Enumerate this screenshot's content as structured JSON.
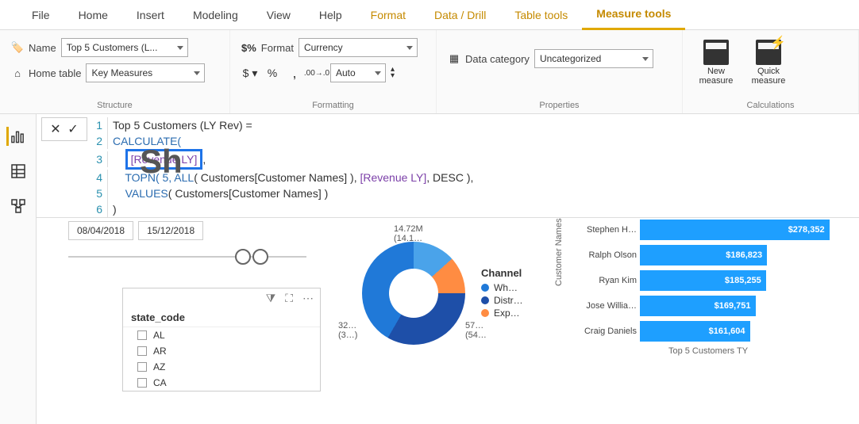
{
  "tabs": {
    "file": "File",
    "home": "Home",
    "insert": "Insert",
    "modeling": "Modeling",
    "view": "View",
    "help": "Help",
    "format": "Format",
    "datadrill": "Data / Drill",
    "tabletools": "Table tools",
    "measuretools": "Measure tools"
  },
  "structure": {
    "name_label": "Name",
    "name_value": "Top 5 Customers (L...",
    "home_label": "Home table",
    "home_value": "Key Measures",
    "group": "Structure"
  },
  "formatting": {
    "format_label": "Format",
    "format_value": "Currency",
    "decimals": "Auto",
    "group": "Formatting"
  },
  "properties": {
    "datacat_label": "Data category",
    "datacat_value": "Uncategorized",
    "group": "Properties"
  },
  "calculations": {
    "new": "New measure",
    "quick": "Quick measure",
    "group": "Calculations"
  },
  "formula": {
    "bg": "Sh",
    "l1": "Top 5 Customers (LY Rev) =",
    "l2": "CALCULATE(",
    "l3a": "[Revenue LY]",
    "l3b": ",",
    "l4a": "TOPN( 5, ",
    "l4b": "ALL",
    "l4c": "( Customers[Customer Names] ), ",
    "l4d": "[Revenue LY]",
    "l4e": ", DESC ),",
    "l5a": "VALUES",
    "l5b": "( Customers[Customer Names] )",
    "l6": ")"
  },
  "dates": {
    "from": "08/04/2018",
    "to": "15/12/2018"
  },
  "slicer": {
    "header": "state_code",
    "items": [
      "AL",
      "AR",
      "AZ",
      "CA"
    ]
  },
  "donut": {
    "legend_title": "Channel",
    "legend": [
      "Wh…",
      "Distr…",
      "Exp…"
    ],
    "labels": {
      "top": "14.72M",
      "top2": "(14.1…",
      "left": "32…",
      "left2": "(3…)",
      "right": "57…",
      "right2": "(54…"
    }
  },
  "chart_data": {
    "type": "bar",
    "title": "Top 5 Customers TY",
    "ylabel": "Customer Names",
    "categories": [
      "Stephen H…",
      "Ralph Olson",
      "Ryan Kim",
      "Jose Willia…",
      "Craig Daniels"
    ],
    "values": [
      278352,
      186823,
      185255,
      169751,
      161604
    ],
    "value_labels": [
      "$278,352",
      "$186,823",
      "$185,255",
      "$169,751",
      "$161,604"
    ],
    "xlim": [
      0,
      280000
    ]
  }
}
